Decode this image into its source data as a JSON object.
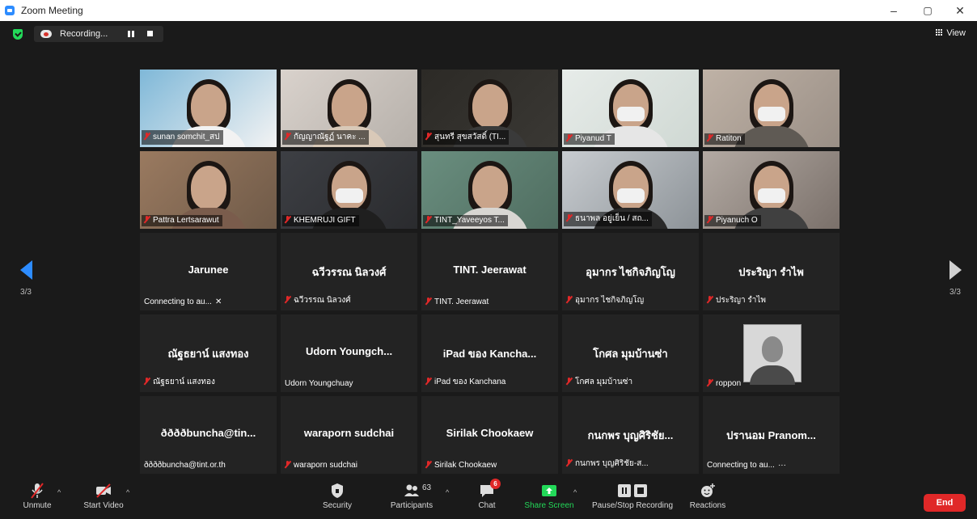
{
  "window": {
    "title": "Zoom Meeting",
    "minimize": "–",
    "restore": "▢",
    "close": "✕"
  },
  "topbar": {
    "recording_label": "Recording...",
    "view_label": "View"
  },
  "pager": {
    "left": "3/3",
    "right": "3/3"
  },
  "tiles": [
    {
      "label": "sunan somchit_สป",
      "muted": true,
      "video": true
    },
    {
      "label": "กัญญาณัฐฏ์ นาคะ ...",
      "muted": true,
      "video": true
    },
    {
      "label": "สุนทรี สุขสวัสดิ์ (TI...",
      "muted": true,
      "video": true
    },
    {
      "label": "Piyanud T",
      "muted": true,
      "video": true
    },
    {
      "label": "Ratiton",
      "muted": true,
      "video": true
    },
    {
      "label": "Pattra Lertsarawut",
      "muted": true,
      "video": true
    },
    {
      "label": "KHEMRUJI GIFT",
      "muted": true,
      "video": true
    },
    {
      "label": "TINT_Yaveeyos T...",
      "muted": true,
      "video": true
    },
    {
      "label": "ธนาพล อยู่เย็น / สถ...",
      "muted": true,
      "video": true
    },
    {
      "label": "Piyanuch O",
      "muted": true,
      "video": true
    },
    {
      "display": "Jarunee",
      "label": "Connecting to au...",
      "suffix": "✕",
      "muted": false
    },
    {
      "display": "ฉวีวรรณ นิลวงศ์",
      "label": "ฉวีวรรณ นิลวงศ์",
      "muted": true
    },
    {
      "display": "TINT. Jeerawat",
      "label": "TINT. Jeerawat",
      "muted": true
    },
    {
      "display": "อุมากร ไชกิจภิญโญ",
      "label": "อุมากร ไชกิจภิญโญ",
      "muted": true
    },
    {
      "display": "ประริญา รำไพ",
      "label": "ประริญา รำไพ",
      "muted": true
    },
    {
      "display": "ณัฐธยาน์ แสงทอง",
      "label": "ณัฐธยาน์ แสงทอง",
      "muted": true
    },
    {
      "display": "Udorn  Youngch...",
      "label": "Udorn Youngchuay",
      "muted": false
    },
    {
      "display": "iPad ของ Kancha...",
      "label": "iPad ของ Kanchana",
      "muted": true
    },
    {
      "display": "โกศล มุมบ้านซ่า",
      "label": "โกศล มุมบ้านซ่า",
      "muted": true
    },
    {
      "display": "",
      "label": "roppon",
      "muted": true,
      "photo": true
    },
    {
      "display": "ððððbuncha@tin...",
      "label": "ððððbuncha@tint.or.th",
      "muted": false
    },
    {
      "display": "waraporn sudchai",
      "label": "waraporn sudchai",
      "muted": true
    },
    {
      "display": "Sirilak Chookaew",
      "label": "Sirilak Chookaew",
      "muted": true
    },
    {
      "display": "กนกพร บุญศิริชัย...",
      "label": "กนกพร บุญศิริชัย-ส...",
      "muted": true
    },
    {
      "display": "ปรานอม Pranom...",
      "label": "Connecting to au...",
      "suffix": "···",
      "muted": false
    }
  ],
  "toolbar": {
    "unmute": "Unmute",
    "start_video": "Start Video",
    "security": "Security",
    "participants": "Participants",
    "participants_count": "63",
    "chat": "Chat",
    "chat_badge": "6",
    "share_screen": "Share Screen",
    "pause_stop_recording": "Pause/Stop Recording",
    "reactions": "Reactions",
    "end": "End",
    "caret": "^"
  },
  "colors": {
    "accent": "#2d8cff",
    "share_green": "#23d959",
    "end_red": "#e02828",
    "muted_red": "#e02828"
  }
}
